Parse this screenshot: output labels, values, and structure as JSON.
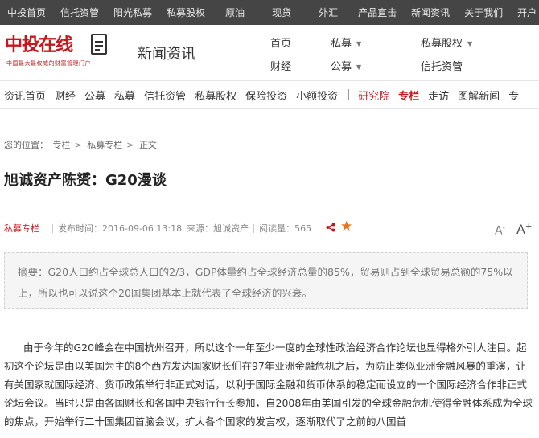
{
  "topbar": {
    "items": [
      "中投首页",
      "信托资管",
      "阳光私募",
      "私募股权",
      "原油",
      "现货",
      "外汇",
      "产品直击",
      "新闻资讯",
      "关于我们",
      "开户"
    ]
  },
  "header": {
    "logo_text": "中投在线",
    "logo_tagline": "中国最大最权威的财富管理门户",
    "section_title": "新闻资讯",
    "nav": {
      "home": "首页",
      "private_fund": "私募",
      "private_equity": "私募股权",
      "finance": "财经",
      "public_fund": "公募",
      "trust": "信托资管"
    }
  },
  "subnav": {
    "items": [
      "资讯首页",
      "财经",
      "公募",
      "私募",
      "信托资管",
      "私募股权",
      "保险投资",
      "小额投资"
    ],
    "extra": [
      "研究院",
      "专栏",
      "走访",
      "图解新闻",
      "专"
    ]
  },
  "breadcrumb": {
    "prefix": "您的位置：",
    "items": [
      "专栏",
      "私募专栏",
      "正文"
    ],
    "arrow": ">"
  },
  "article": {
    "title": "旭诚资产陈赟：G20漫谈",
    "category": "私募专栏",
    "publish_time": "发布时间：2016-09-06 13:18",
    "source": "来源：旭诚资产",
    "views": "阅读量：565",
    "font_small": "A",
    "font_large": "A",
    "summary": "摘要：G20人口约占全球总人口的2/3，GDP体量约占全球经济总量的85%，贸易则占到全球贸易总额的75%以上，所以也可以说这个20国集团基本上就代表了全球经济的兴衰。",
    "body": "由于今年的G20峰会在中国杭州召开，所以这个一年至少一度的全球性政治经济合作论坛也显得格外引人注目。起初这个论坛是由以美国为主的8个西方发达国家财长们在97年亚洲金融危机之后，为防止类似亚洲金融风暴的重演，让有关国家就国际经济、货币政策举行非正式对话，以利于国际金融和货币体系的稳定而设立的一个国际经济合作非正式论坛会议。当时只是由各国财长和各国中央银行行长参加，自2008年由美国引发的全球金融危机使得金融体系成为全球的焦点，开始举行二十国集团首脑会议，扩大各个国家的发言权，逐渐取代了之前的八国首"
  },
  "colors": {
    "brand_red": "#c8161d",
    "topbar_bg": "#454545",
    "star": "#e8741a"
  }
}
